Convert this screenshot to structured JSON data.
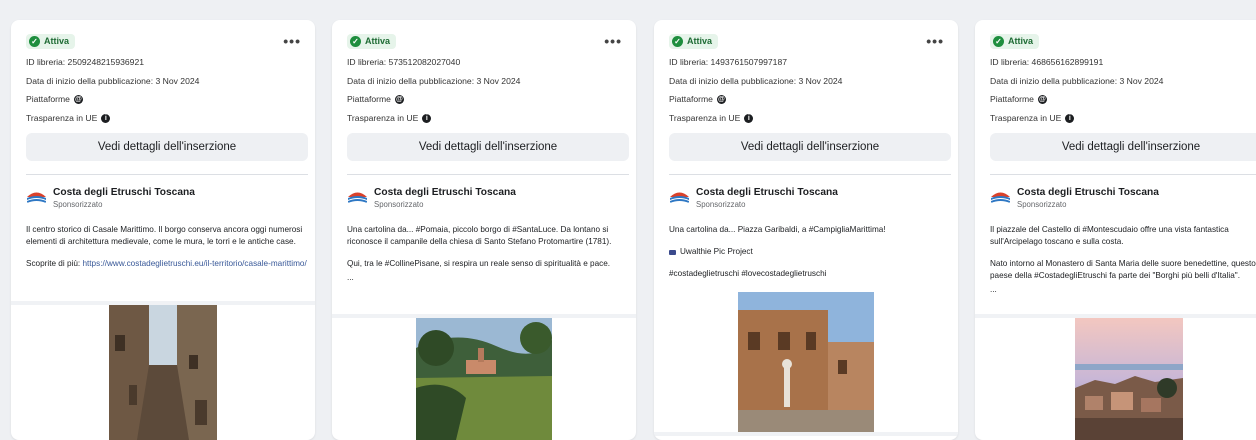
{
  "cards": [
    {
      "status": "Attiva",
      "library_id": "ID libreria: 2509248215936921",
      "start_date": "Data di inizio della pubblicazione: 3 Nov 2024",
      "platforms": "Piattaforme",
      "transparency": "Trasparenza in UE",
      "details_button": "Vedi dettagli dell'inserzione",
      "page_name": "Costa degli Etruschi Toscana",
      "sponsored": "Sponsorizzato",
      "text1": "Il centro storico di Casale Marittimo. Il borgo conserva ancora oggi numerosi elementi di architettura medievale, come le mura, le torri e le antiche case.",
      "text2_prefix": "Scoprite di più: ",
      "text2_link": "https://www.costadeglietruschi.eu/il-territorio/casale-marittimo/",
      "image": "medieval-alley-photo"
    },
    {
      "status": "Attiva",
      "library_id": "ID libreria: 573512082027040",
      "start_date": "Data di inizio della pubblicazione: 3 Nov 2024",
      "platforms": "Piattaforme",
      "transparency": "Trasparenza in UE",
      "details_button": "Vedi dettagli dell'inserzione",
      "page_name": "Costa degli Etruschi Toscana",
      "sponsored": "Sponsorizzato",
      "text1": "Una cartolina da... #Pomaia, piccolo borgo di #SantaLuce. Da lontano si riconosce il campanile della chiesa di Santo Stefano Protomartire (1781).",
      "text2": "Qui, tra le #CollinePisane, si respira un reale senso di spiritualità e pace.",
      "text3": "...",
      "image": "hillside-village-photo"
    },
    {
      "status": "Attiva",
      "library_id": "ID libreria: 1493761507997187",
      "start_date": "Data di inizio della pubblicazione: 3 Nov 2024",
      "platforms": "Piattaforme",
      "transparency": "Trasparenza in UE",
      "details_button": "Vedi dettagli dell'inserzione",
      "page_name": "Costa degli Etruschi Toscana",
      "sponsored": "Sponsorizzato",
      "text1": "Una cartolina da... Piazza Garibaldi, a #CampigliaMarittima!",
      "text2": "Uwalthie Pic Project",
      "text3": "#costadeglietruschi #lovecostadeglietruschi",
      "image": "piazza-fountain-photo"
    },
    {
      "status": "Attiva",
      "library_id": "ID libreria: 468656162899191",
      "start_date": "Data di inizio della pubblicazione: 3 Nov 2024",
      "platforms": "Piattaforme",
      "transparency": "Trasparenza in UE",
      "details_button": "Vedi dettagli dell'inserzione",
      "page_name": "Costa degli Etruschi Toscana",
      "sponsored": "Sponsorizzato",
      "text1": "Il piazzale del Castello di #Montescudaio offre una vista fantastica sull'Arcipelago toscano e sulla costa.",
      "text2": "Nato intorno al Monastero di Santa Maria delle suore benedettine, questo paese della #CostadegliEtruschi fa parte dei \"Borghi più belli d'Italia\".",
      "text3": "...",
      "image": "sunset-village-photo"
    }
  ],
  "colors": {
    "badge_bg": "#e6f4ea",
    "badge_text": "#1e6b34",
    "link": "#385898",
    "page_bg": "#eef0f3"
  }
}
